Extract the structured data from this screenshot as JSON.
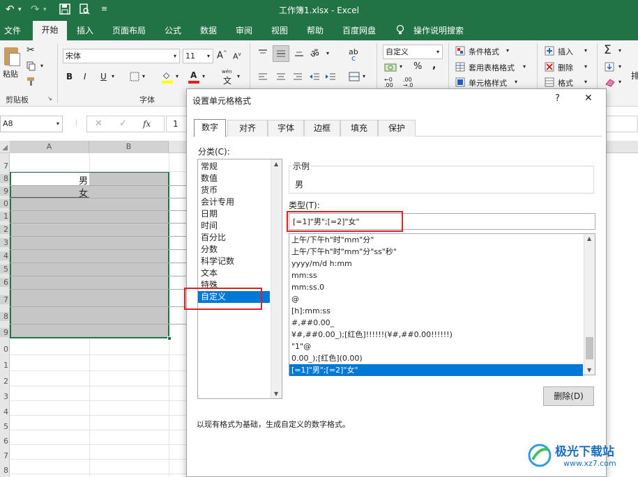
{
  "app": {
    "title": "工作簿1.xlsx  -  Excel"
  },
  "menu": {
    "items": [
      "文件",
      "开始",
      "插入",
      "页面布局",
      "公式",
      "数据",
      "审阅",
      "视图",
      "帮助",
      "百度网盘",
      "操作说明搜索"
    ]
  },
  "ribbon": {
    "paste": "粘贴",
    "clipboard_label": "剪贴板",
    "font_name": "宋体",
    "font_size": "11",
    "font_label": "字体",
    "number_format": "自定义",
    "conditional_format": "条件格式",
    "table_format": "套用表格格式",
    "cell_style": "单元格样式",
    "insert": "插入",
    "delete": "删除",
    "format": "格式",
    "bold": "B",
    "italic": "I",
    "underline": "U",
    "wen": "wén",
    "wen_char": "文",
    "percent": "%",
    "comma": ",",
    "ab": "ab",
    "wrap": "c",
    "sigma": "Σ",
    "truncated": "排"
  },
  "formula": {
    "name_box": "A8",
    "fx": "fx",
    "value": "1"
  },
  "sheet": {
    "columns": [
      "A",
      "B"
    ],
    "rows": [
      "7",
      "8",
      "9",
      "0",
      "1",
      "2",
      "3",
      "4",
      "5",
      "6",
      "7",
      "8",
      "9",
      "0",
      "1",
      "2",
      "3",
      "4",
      "5",
      "6",
      "7",
      "8"
    ],
    "cell_a8": "男",
    "cell_a9": "女"
  },
  "dialog": {
    "title": "设置单元格格式",
    "help": "?",
    "close": "✕",
    "tabs": [
      "数字",
      "对齐",
      "字体",
      "边框",
      "填充",
      "保护"
    ],
    "category_label": "分类(C):",
    "categories": [
      "常规",
      "数值",
      "货币",
      "会计专用",
      "日期",
      "时间",
      "百分比",
      "分数",
      "科学记数",
      "文本",
      "特殊",
      "自定义"
    ],
    "selected_category": "自定义",
    "sample_label": "示例",
    "sample_value": "男",
    "type_label": "类型(T):",
    "type_value": "[=1]\"男\";[=2]\"女\"",
    "format_list": [
      "上午/下午h\"时\"mm\"分\"",
      "上午/下午h\"时\"mm\"分\"ss\"秒\"",
      "yyyy/m/d h:mm",
      "mm:ss",
      "mm:ss.0",
      "@",
      "[h]:mm:ss",
      "#,##0.00_",
      "¥#,##0.00_);[红色]!!!!!!(¥#,##0.00!!!!!!)",
      "\"1\"@",
      "0.00_);[红色](0.00)",
      "[=1]\"男\";[=2]\"女\""
    ],
    "selected_format": "[=1]\"男\";[=2]\"女\"",
    "delete_button": "删除(D)",
    "description": "以现有格式为基础，生成自定义的数字格式。"
  },
  "watermark": {
    "name": "极光下载站",
    "url": "www.xz7.com"
  },
  "colors": {
    "excel_green": "#217346",
    "selection_blue": "#0078d7",
    "highlight_red": "#e02020"
  }
}
